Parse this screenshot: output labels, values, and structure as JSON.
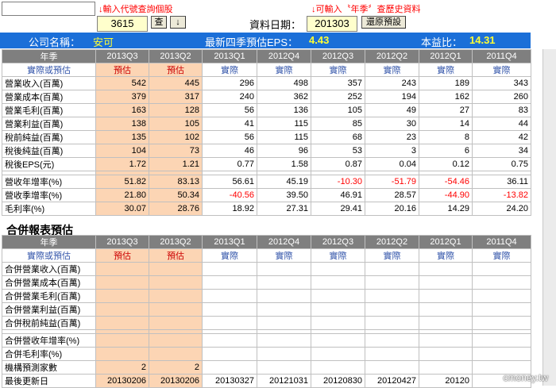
{
  "topbar": {
    "hint_code": "↓輸入代號查詢個股",
    "hint_season": "↓可輸入〝年季〞查歷史資料",
    "stock_code": "3615",
    "query_button": "查",
    "down_button": "↓",
    "date_label": "資料日期：",
    "date_value": "201303",
    "restore_button": "還原預設"
  },
  "summary": {
    "company_label": "公司名稱：",
    "company_name": "安可",
    "eps_label": "最新四季預估EPS：",
    "eps_value": "4.43",
    "pe_label": "本益比：",
    "pe_value": "14.31"
  },
  "table1": {
    "header_label": "年季",
    "columns": [
      "2013Q3",
      "2013Q2",
      "2013Q1",
      "2012Q4",
      "2012Q3",
      "2012Q2",
      "2012Q1",
      "2011Q4"
    ],
    "sub_label": "實際或預估",
    "sub_values": [
      "預估",
      "預估",
      "實際",
      "實際",
      "實際",
      "實際",
      "實際",
      "實際"
    ],
    "rows": [
      {
        "label": "營業收入(百萬)",
        "values": [
          "542",
          "445",
          "296",
          "498",
          "357",
          "243",
          "189",
          "343"
        ]
      },
      {
        "label": "營業成本(百萬)",
        "values": [
          "379",
          "317",
          "240",
          "362",
          "252",
          "194",
          "162",
          "260"
        ]
      },
      {
        "label": "營業毛利(百萬)",
        "values": [
          "163",
          "128",
          "56",
          "136",
          "105",
          "49",
          "27",
          "83"
        ]
      },
      {
        "label": "營業利益(百萬)",
        "values": [
          "138",
          "105",
          "41",
          "115",
          "85",
          "30",
          "14",
          "44"
        ]
      },
      {
        "label": "稅前純益(百萬)",
        "values": [
          "135",
          "102",
          "56",
          "115",
          "68",
          "23",
          "8",
          "42"
        ]
      },
      {
        "label": "稅後純益(百萬)",
        "values": [
          "104",
          "73",
          "46",
          "96",
          "53",
          "3",
          "6",
          "34"
        ]
      },
      {
        "label": "稅後EPS(元)",
        "values": [
          "1.72",
          "1.21",
          "0.77",
          "1.58",
          "0.87",
          "0.04",
          "0.12",
          "0.75"
        ]
      }
    ],
    "rows2": [
      {
        "label": "營收年增率(%)",
        "values": [
          "51.82",
          "83.13",
          "56.61",
          "45.19",
          "-10.30",
          "-51.79",
          "-54.46",
          "36.11"
        ]
      },
      {
        "label": "營收季增率(%)",
        "values": [
          "21.80",
          "50.34",
          "-40.56",
          "39.50",
          "46.91",
          "28.57",
          "-44.90",
          "-13.82"
        ]
      },
      {
        "label": "毛利率(%)",
        "values": [
          "30.07",
          "28.76",
          "18.92",
          "27.31",
          "29.41",
          "20.16",
          "14.29",
          "24.20"
        ]
      }
    ]
  },
  "section_title": "合併報表預估",
  "table2": {
    "header_label": "年季",
    "columns": [
      "2013Q3",
      "2013Q2",
      "2013Q1",
      "2012Q4",
      "2012Q3",
      "2012Q2",
      "2012Q1",
      "2011Q4"
    ],
    "sub_label": "實際或預估",
    "sub_values": [
      "預估",
      "預估",
      "實際",
      "實際",
      "實際",
      "實際",
      "實際",
      "實際"
    ],
    "rows": [
      {
        "label": "合併營業收入(百萬)"
      },
      {
        "label": "合併營業成本(百萬)"
      },
      {
        "label": "合併營業毛利(百萬)"
      },
      {
        "label": "合併營業利益(百萬)"
      },
      {
        "label": "合併稅前純益(百萬)"
      }
    ],
    "rows2": [
      {
        "label": "合併營收年增率(%)"
      },
      {
        "label": "合併毛利率(%)"
      }
    ],
    "institution_label": "機構預測家數",
    "institution_values": [
      "2",
      "2",
      "",
      "",
      "",
      "",
      "",
      ""
    ],
    "update_label": "最後更新日",
    "update_values": [
      "20130206",
      "20130206",
      "20130327",
      "20121031",
      "20120830",
      "20120427",
      "20120",
      ""
    ]
  },
  "watermark": "cmoney.tw"
}
